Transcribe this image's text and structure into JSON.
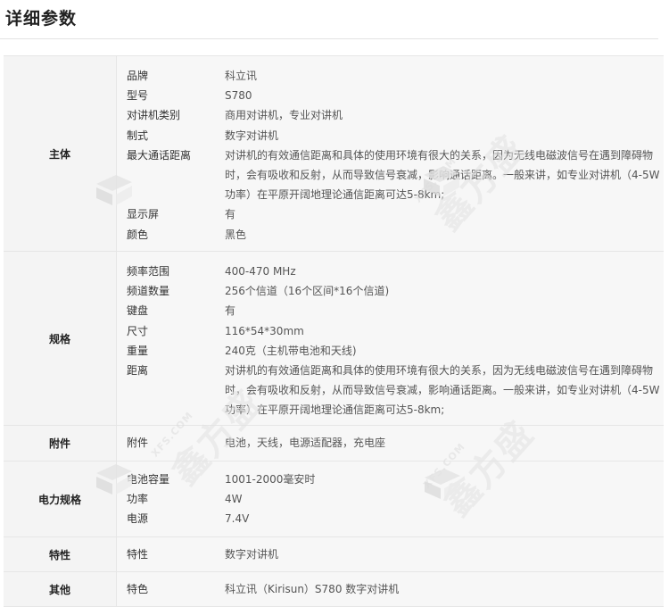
{
  "page": {
    "title": "详细参数"
  },
  "spec_groups": [
    {
      "name": "主体",
      "rows": [
        {
          "label": "品牌",
          "value": "科立讯"
        },
        {
          "label": "型号",
          "value": "S780"
        },
        {
          "label": "对讲机类别",
          "value": "商用对讲机，专业对讲机"
        },
        {
          "label": "制式",
          "value": "数字对讲机"
        },
        {
          "label": "最大通话距离",
          "value": "对讲机的有效通信距离和具体的使用环境有很大的关系，因为无线电磁波信号在遇到障碍物时，会有吸收和反射，从而导致信号衰减，影响通话距离。一般来讲，如专业对讲机（4-5W功率）在平原开阔地理论通信距离可达5-8km;"
        },
        {
          "label": "显示屏",
          "value": "有"
        },
        {
          "label": "颜色",
          "value": "黑色"
        }
      ]
    },
    {
      "name": "规格",
      "rows": [
        {
          "label": "频率范围",
          "value": "400-470 MHz"
        },
        {
          "label": "频道数量",
          "value": "256个信道（16个区间*16个信道)"
        },
        {
          "label": "键盘",
          "value": "有"
        },
        {
          "label": "尺寸",
          "value": "116*54*30mm"
        },
        {
          "label": "重量",
          "value": "240克（主机带电池和天线)"
        },
        {
          "label": "距离",
          "value": "对讲机的有效通信距离和具体的使用环境有很大的关系，因为无线电磁波信号在遇到障碍物时，会有吸收和反射，从而导致信号衰减，影响通话距离。一般来讲，如专业对讲机（4-5W功率）在平原开阔地理论通信距离可达5-8km;"
        }
      ]
    },
    {
      "name": "附件",
      "rows": [
        {
          "label": "附件",
          "value": "电池，天线，电源适配器，充电座"
        }
      ]
    },
    {
      "name": "电力规格",
      "rows": [
        {
          "label": "电池容量",
          "value": "1001-2000毫安时"
        },
        {
          "label": "功率",
          "value": "4W"
        },
        {
          "label": "电源",
          "value": "7.4V"
        }
      ]
    },
    {
      "name": "特性",
      "rows": [
        {
          "label": "特性",
          "value": "数字对讲机"
        }
      ]
    },
    {
      "name": "其他",
      "rows": [
        {
          "label": "特色",
          "value": "科立讯（Kirisun）S780 数字对讲机"
        }
      ]
    }
  ],
  "watermark": {
    "brand": "鑫方盛",
    "domain": "XFS.COM"
  }
}
